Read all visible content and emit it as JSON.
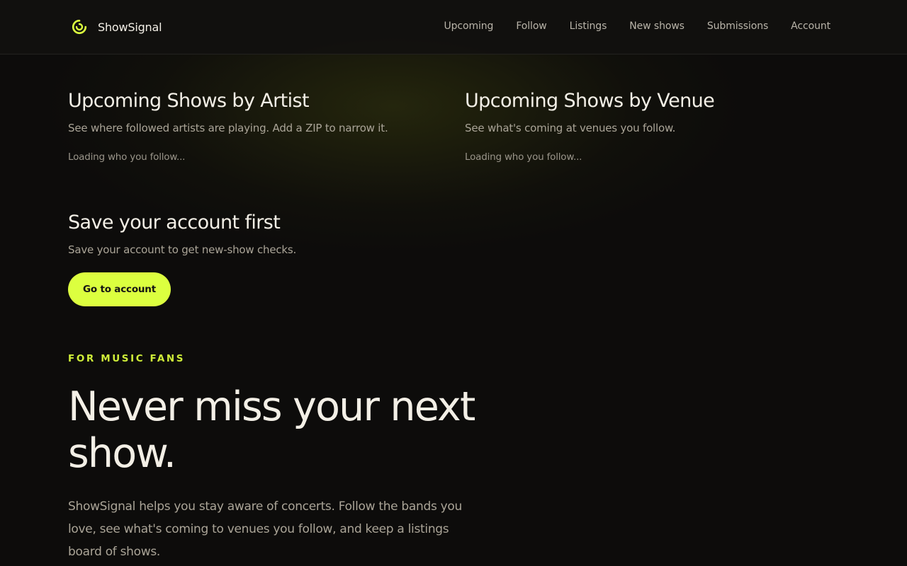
{
  "brand": {
    "name": "ShowSignal",
    "logo_icon": "spiral-logo-icon",
    "accent": "#dcff3f"
  },
  "nav": {
    "items": [
      {
        "label": "Upcoming"
      },
      {
        "label": "Follow"
      },
      {
        "label": "Listings"
      },
      {
        "label": "New shows"
      },
      {
        "label": "Submissions"
      },
      {
        "label": "Account"
      }
    ]
  },
  "artists": {
    "title": "Upcoming Shows by Artist",
    "desc": "See where followed artists are playing. Add a ZIP to narrow it.",
    "loading": "Loading who you follow..."
  },
  "venues": {
    "title": "Upcoming Shows by Venue",
    "desc": "See what's coming at venues you follow.",
    "loading": "Loading who you follow..."
  },
  "account_prompt": {
    "title": "Save your account first",
    "desc": "Save your account to get new-show checks.",
    "button_label": "Go to account"
  },
  "hero": {
    "eyebrow": "FOR MUSIC FANS",
    "title": "Never miss your next show.",
    "body": "ShowSignal helps you stay aware of concerts. Follow the bands you love, see what's coming to venues you follow, and keep a listings board of shows."
  }
}
